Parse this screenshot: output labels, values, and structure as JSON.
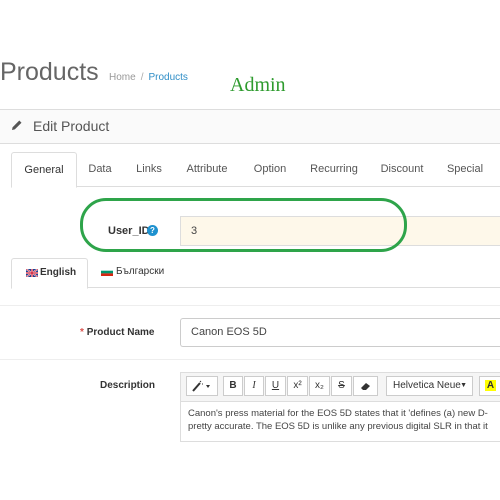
{
  "header": {
    "title": "Products",
    "breadcrumb": [
      "Home",
      "Products"
    ],
    "annotation": "Admin"
  },
  "panel": {
    "heading": "Edit Product",
    "icon": "pencil-icon"
  },
  "tabs": [
    "General",
    "Data",
    "Links",
    "Attribute",
    "Option",
    "Recurring",
    "Discount",
    "Special"
  ],
  "active_tab": "General",
  "user_field": {
    "label": "User_ID",
    "value": "3",
    "help_icon": "question-circle-icon",
    "highlight_color": "#2ea44a"
  },
  "languages": [
    {
      "label": "English",
      "flag": "uk-flag-icon"
    },
    {
      "label": "Български",
      "flag": "bulgaria-flag-icon"
    }
  ],
  "product_name": {
    "required_mark": "*",
    "label": "Product Name",
    "value": "Canon EOS 5D"
  },
  "description": {
    "label": "Description",
    "toolbar": {
      "bold": "B",
      "italic": "I",
      "underline": "U",
      "superscript": "x²",
      "subscript": "x₂",
      "strikethrough": "S",
      "font_name": "Helvetica Neue",
      "font_color": "A"
    },
    "text_lines": [
      "Canon's press material for the EOS 5D states that it 'defines (a) new D-",
      "pretty accurate. The EOS 5D is unlike any previous digital SLR in that it"
    ]
  },
  "colors": {
    "accent": "#1e91cf",
    "link": "#2f8ec7",
    "required": "#d9534f",
    "input_highlight": "#fef8ea"
  }
}
